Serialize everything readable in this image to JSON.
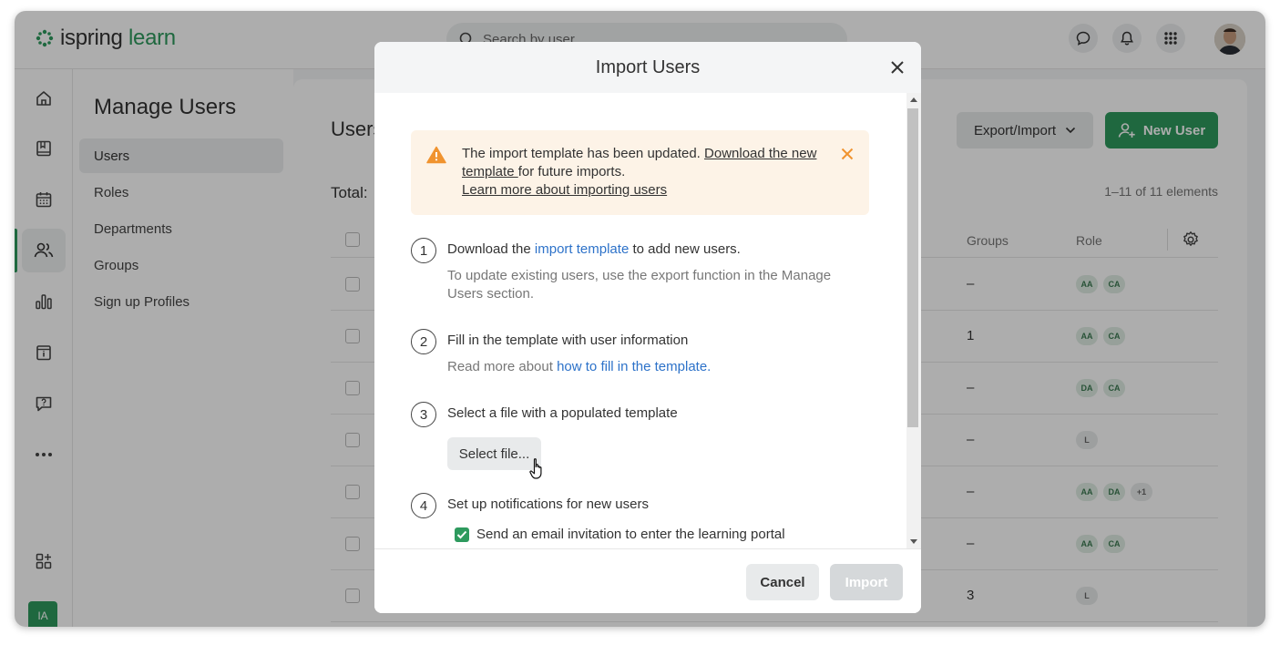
{
  "app": {
    "logo_part1": "ispring",
    "logo_part2": "learn",
    "search_placeholder": "Search by user",
    "user_initials": "IA"
  },
  "subnav": {
    "title": "Manage Users",
    "items": [
      {
        "label": "Users",
        "active": true
      },
      {
        "label": "Roles"
      },
      {
        "label": "Departments"
      },
      {
        "label": "Groups"
      },
      {
        "label": "Sign up Profiles"
      }
    ]
  },
  "main": {
    "title": "Users",
    "total_label": "Total:",
    "export_label": "Export/Import",
    "new_user_label": "New User",
    "count_text": "1–11 of 11 elements",
    "columns": {
      "groups": "Groups",
      "role": "Role"
    },
    "rows": [
      {
        "groups": "–",
        "roles": [
          "AA",
          "CA"
        ]
      },
      {
        "groups": "1",
        "roles": [
          "AA",
          "CA"
        ]
      },
      {
        "groups": "–",
        "roles": [
          "DA",
          "CA"
        ]
      },
      {
        "groups": "–",
        "roles": [
          "L"
        ]
      },
      {
        "groups": "–",
        "roles": [
          "AA",
          "DA",
          "+1"
        ]
      },
      {
        "groups": "–",
        "roles": [
          "AA",
          "CA"
        ]
      },
      {
        "groups": "3",
        "roles": [
          "L"
        ]
      }
    ]
  },
  "modal": {
    "title": "Import Users",
    "alert": {
      "text1": "The import template has been updated. ",
      "link1": "Download the new template ",
      "text2": "for future imports.",
      "link2": "Learn more about importing users"
    },
    "steps": [
      {
        "num": "1",
        "title_pre": "Download the ",
        "title_link": "import template",
        "title_post": " to add new users.",
        "desc": "To update existing users, use the export function in the Manage Users section."
      },
      {
        "num": "2",
        "title": "Fill in the template with user information",
        "desc_pre": "Read more about ",
        "desc_link": "how to fill in the template."
      },
      {
        "num": "3",
        "title": "Select a file with a populated template",
        "button": "Select file..."
      },
      {
        "num": "4",
        "title": "Set up notifications for new users",
        "checkbox_label": "Send an email invitation to enter the learning portal"
      }
    ],
    "cancel_label": "Cancel",
    "import_label": "Import"
  },
  "colors": {
    "brand_green": "#2e9a5e",
    "alert_bg": "#fdf3e7",
    "alert_orange": "#f0932f",
    "link_blue": "#2d72c9"
  }
}
